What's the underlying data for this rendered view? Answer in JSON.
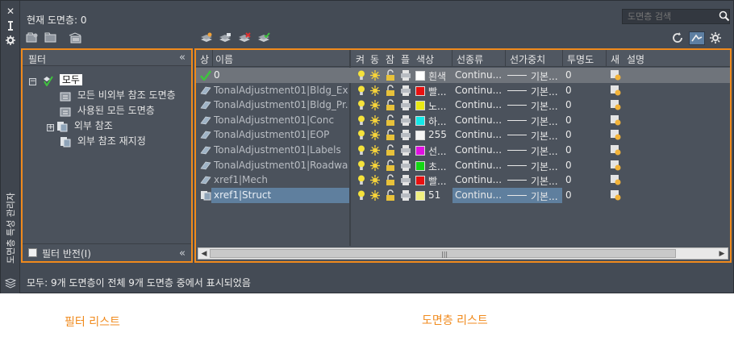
{
  "window": {
    "title": "도면층 특성 관리자",
    "current_layer_label": "현재 도면층: 0",
    "search_placeholder": "도면층 검색",
    "status_text": "모두: 9개 도면층이 전체 9개 도면층 중에서 표시되었음"
  },
  "toolbar_left": [
    "new-property-filter-icon",
    "new-group-filter-icon",
    "layer-states-manager-icon"
  ],
  "toolbar_mid": [
    "new-layer-icon",
    "new-layer-vp-frozen-icon",
    "delete-layer-icon",
    "set-current-icon"
  ],
  "toolbar_right": [
    "refresh-icon",
    "settings-icon"
  ],
  "filter_panel": {
    "header": "필터",
    "tree": [
      {
        "label": "모두",
        "level": 0,
        "expander": "−",
        "selected": true
      },
      {
        "label": "모든 비외부 참조 도면층",
        "level": 1
      },
      {
        "label": "사용된 모든 도면층",
        "level": 1
      },
      {
        "label": "외부 참조",
        "level": 1,
        "expander": "+"
      },
      {
        "label": "외부 참조 재지정",
        "level": 1
      }
    ],
    "invert_label": "필터 반전(I)"
  },
  "layer_panel": {
    "columns": {
      "status": "상",
      "name": "이름",
      "on": "켜",
      "freeze": "동",
      "lock": "잠",
      "plot": "플",
      "color": "색상",
      "linetype": "선종류",
      "lineweight": "선가중치",
      "transparency": "투명도",
      "new_vp_freeze": "새",
      "description": "설명"
    },
    "rows": [
      {
        "name": "0",
        "current": true,
        "color_hex": "#ffffff",
        "color_name": "흰색",
        "linetype": "Continu...",
        "lineweight": "기본...",
        "transparency": "0"
      },
      {
        "name": "TonalAdjustment01|Bldg_Ex...",
        "color_hex": "#e81010",
        "color_name": "빨...",
        "linetype": "Continu...",
        "lineweight": "기본...",
        "transparency": "0"
      },
      {
        "name": "TonalAdjustment01|Bldg_Pr...",
        "color_hex": "#e8e814",
        "color_name": "노...",
        "linetype": "Continu...",
        "lineweight": "기본...",
        "transparency": "0"
      },
      {
        "name": "TonalAdjustment01|Conc",
        "color_hex": "#14e8e8",
        "color_name": "하...",
        "linetype": "Continu...",
        "lineweight": "기본...",
        "transparency": "0"
      },
      {
        "name": "TonalAdjustment01|EOP",
        "color_hex": "#f4f4f4",
        "color_name": "255",
        "linetype": "Continu...",
        "lineweight": "기본...",
        "transparency": "0"
      },
      {
        "name": "TonalAdjustment01|Labels",
        "color_hex": "#e010e0",
        "color_name": "선...",
        "linetype": "Continu...",
        "lineweight": "기본...",
        "transparency": "0"
      },
      {
        "name": "TonalAdjustment01|Roadway",
        "color_hex": "#14d814",
        "color_name": "초...",
        "linetype": "Continu...",
        "lineweight": "기본...",
        "transparency": "0"
      },
      {
        "name": "xref1|Mech",
        "color_hex": "#e81010",
        "color_name": "빨...",
        "linetype": "Continu...",
        "lineweight": "기본...",
        "transparency": "0"
      },
      {
        "name": "xref1|Struct",
        "selected": true,
        "color_hex": "#f0f080",
        "color_name": "51",
        "linetype": "Continu...",
        "lineweight": "기본...",
        "transparency": "0"
      }
    ]
  },
  "captions": {
    "filter_list": "필터 리스트",
    "layer_list": "도면층 리스트"
  },
  "colors": {
    "highlight_orange": "#f08a1c",
    "panel_bg": "#4b525c",
    "selection_blue": "#5f7f9e"
  }
}
